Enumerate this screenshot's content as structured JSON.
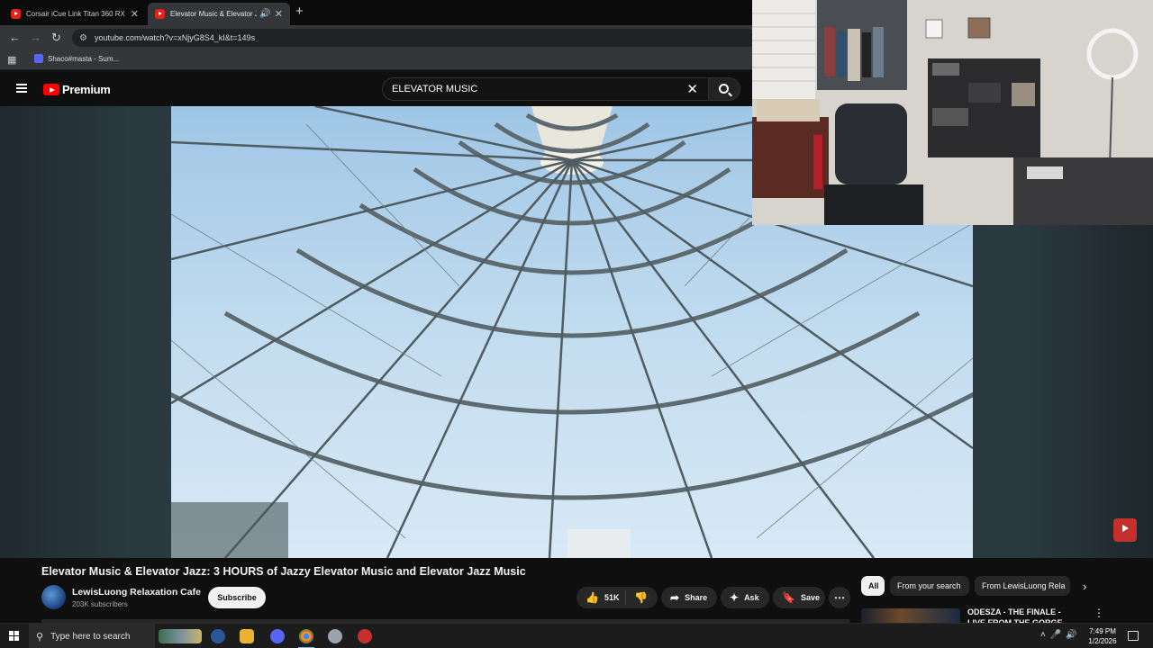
{
  "browser": {
    "tabs": [
      {
        "title": "Corsair iCue Link Titan 360 RX R"
      },
      {
        "title": "Elevator Music & Elevator J"
      }
    ],
    "url": "youtube.com/watch?v=xNjyG8S4_kI&t=149s",
    "bookmark": "Shaco#masta - Sum..."
  },
  "header": {
    "brand": "Premium",
    "search_value": "ELEVATOR MUSIC"
  },
  "video": {
    "title": "Elevator Music & Elevator Jazz: 3 HOURS of Jazzy Elevator Music and Elevator Jazz Music",
    "channel": "LewisLuong Relaxation Cafe",
    "subscribers": "203K subscribers",
    "subscribe_label": "Subscribe",
    "likes": "51K",
    "share_label": "Share",
    "ask_label": "Ask",
    "save_label": "Save"
  },
  "sidebar": {
    "chips": [
      "All",
      "From your search",
      "From LewisLuong Rela"
    ],
    "recommendation": {
      "title": "ODESZA - THE FINALE - LIVE FROM THE GORGE"
    }
  },
  "taskbar": {
    "search_placeholder": "Type here to search",
    "time": "7:49 PM",
    "date": "1/2/2026"
  }
}
